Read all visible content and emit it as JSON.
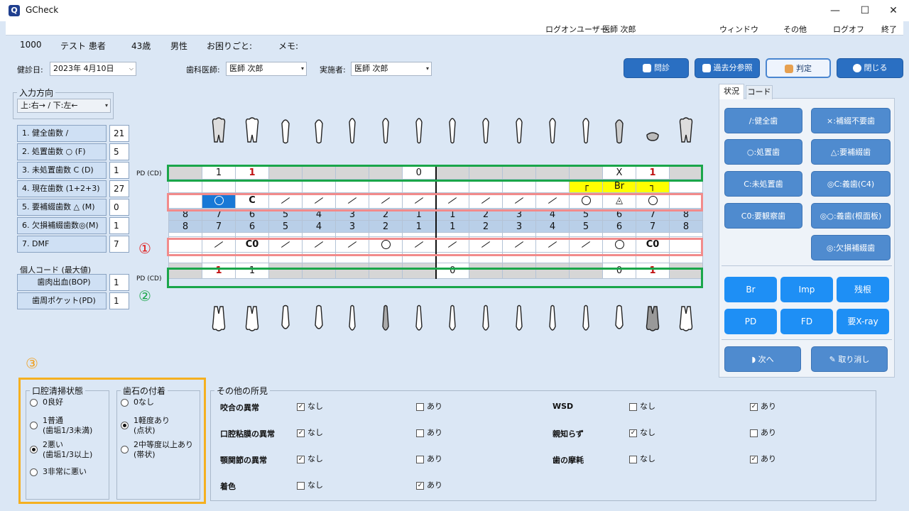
{
  "window": {
    "title": "GCheck",
    "app_icon": "app-logo-icon"
  },
  "menubar": {
    "user_label": "ログオンユーザー:",
    "user": "医師 次郎",
    "items": [
      "ウィンドウ",
      "その他",
      "ログオフ",
      "終了"
    ]
  },
  "patient": {
    "id": "1000",
    "name": "テスト 患者",
    "age": "43歳",
    "sex": "男性",
    "trouble_label": "お困りごと:",
    "memo_label": "メモ:"
  },
  "form": {
    "date_label": "健診日:",
    "date": "2023年 4月10日",
    "dentist_label": "歯科医師:",
    "dentist": "医師 次郎",
    "performer_label": "実施者:",
    "performer": "医師 次郎"
  },
  "buttons": {
    "interview": "問診",
    "history": "過去分参照",
    "judge": "判定",
    "close": "閉じる"
  },
  "input_direction": {
    "label": "入力方向",
    "value": "上:右→ / 下:左←"
  },
  "counts": [
    {
      "label": "1. 健全歯数 /",
      "value": "21"
    },
    {
      "label": "2. 処置歯数 ○ (F)",
      "value": "5"
    },
    {
      "label": "3. 未処置歯数 C (D)",
      "value": "1"
    },
    {
      "label": "4. 現在歯数 (1+2+3)",
      "value": "27"
    },
    {
      "label": "5. 要補綴歯数 △ (M)",
      "value": "0"
    },
    {
      "label": "6. 欠損補綴歯数◎(M)",
      "value": "1"
    },
    {
      "label": "7. DMF",
      "value": "7"
    }
  ],
  "personal": {
    "label": "個人コード (最大値)",
    "items": [
      {
        "label": "歯肉出血(BOP)",
        "value": "1"
      },
      {
        "label": "歯周ポケット(PD)",
        "value": "1"
      }
    ]
  },
  "chart": {
    "pd_label": "PD (CD)",
    "upper_pd": [
      "",
      "1",
      "1",
      "",
      "",
      "",
      "",
      "0",
      "",
      "",
      "",
      "",
      "",
      "X",
      "1",
      ""
    ],
    "upper_br": [
      "",
      "",
      "",
      "",
      "",
      "",
      "",
      "",
      "",
      "",
      "",
      "",
      "┌",
      "Br",
      "┐",
      ""
    ],
    "upper_status": [
      "",
      "○",
      "C",
      "/",
      "/",
      "/",
      "/",
      "/",
      "/",
      "/",
      "/",
      "/",
      "○",
      "◬",
      "○",
      ""
    ],
    "numbers": [
      "8",
      "7",
      "6",
      "5",
      "4",
      "3",
      "2",
      "1",
      "1",
      "2",
      "3",
      "4",
      "5",
      "6",
      "7",
      "8"
    ],
    "lower_status": [
      "",
      "/",
      "C0",
      "/",
      "/",
      "/",
      "○",
      "/",
      "/",
      "/",
      "/",
      "/",
      "/",
      "○",
      "C0",
      ""
    ],
    "lower_pd": [
      "",
      "1",
      "1",
      "",
      "",
      "",
      "",
      "",
      "0",
      "",
      "",
      "",
      "",
      "0",
      "1",
      ""
    ],
    "markers": {
      "one": "①",
      "two": "②",
      "three": "③"
    }
  },
  "right_panel": {
    "tabs": [
      "状況",
      "コード"
    ],
    "status_buttons": [
      "/:健全歯",
      "×:補綴不要歯",
      "○:処置歯",
      "△:要補綴歯",
      "C:未処置歯",
      "◎C:義歯(C4)",
      "C0:要観察歯",
      "◎○:義歯(根面板)",
      "◎:欠損補綴歯"
    ],
    "code_buttons": [
      "Br",
      "Imp",
      "残根",
      "PD",
      "FD",
      "要X-ray"
    ],
    "next": "次へ",
    "cancel": "取り消し"
  },
  "oral": {
    "clean_title": "口腔清掃状態",
    "clean_options": [
      {
        "label": "0良好",
        "on": false
      },
      {
        "label": "1普通\n(歯垢1/3未満)",
        "on": false
      },
      {
        "label": "2悪い\n(歯垢1/3以上)",
        "on": true
      },
      {
        "label": "3非常に悪い",
        "on": false
      }
    ],
    "calc_title": "歯石の付着",
    "calc_options": [
      {
        "label": "0なし",
        "on": false
      },
      {
        "label": "1軽度あり\n(点状)",
        "on": true
      },
      {
        "label": "2中等度以上あり\n(帯状)",
        "on": false
      }
    ]
  },
  "other": {
    "title": "その他の所見",
    "none": "なし",
    "yes": "あり",
    "left": [
      {
        "label": "咬合の異常",
        "none": true,
        "yes": false
      },
      {
        "label": "口腔粘膜の異常",
        "none": true,
        "yes": false
      },
      {
        "label": "顎関節の異常",
        "none": true,
        "yes": false
      },
      {
        "label": "着色",
        "none": false,
        "yes": true
      }
    ],
    "right": [
      {
        "label": "WSD",
        "none": false,
        "yes": true
      },
      {
        "label": "親知らず",
        "none": true,
        "yes": false
      },
      {
        "label": "歯の摩耗",
        "none": false,
        "yes": true
      }
    ]
  }
}
